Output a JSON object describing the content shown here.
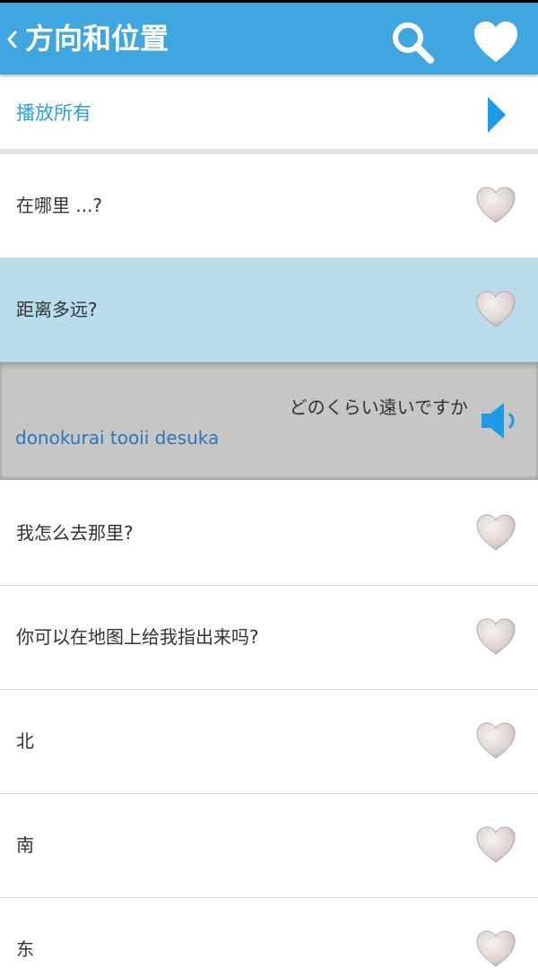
{
  "header": {
    "title": "方向和位置"
  },
  "play_all": {
    "label": "播放所有"
  },
  "phrases": [
    {
      "label": "在哪里 ...?"
    },
    {
      "label": "距离多远?"
    },
    {
      "label": "我怎么去那里?"
    },
    {
      "label": "你可以在地图上给我指出来吗?"
    },
    {
      "label": "北"
    },
    {
      "label": "南"
    },
    {
      "label": "东"
    }
  ],
  "expanded": {
    "japanese": "どのくらい遠いですか",
    "romaji": "donokurai tooii desuka"
  },
  "colors": {
    "appbar": "#3fa6df",
    "accent": "#2a9fe0",
    "selected_row": "#b9dced",
    "expanded_panel": "#c6c6c6"
  },
  "icons": {
    "back": "chevron-left-icon",
    "search": "search-icon",
    "favorites": "heart-icon",
    "play": "play-icon",
    "favorite_toggle": "heart-icon",
    "audio": "speaker-icon"
  }
}
